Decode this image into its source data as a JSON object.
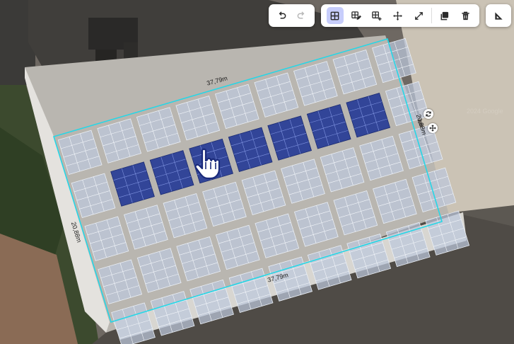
{
  "toolbar": {
    "history": [
      {
        "name": "undo-button",
        "icon": "undo-icon",
        "disabled": false
      },
      {
        "name": "redo-button",
        "icon": "redo-icon",
        "disabled": true
      }
    ],
    "tools": [
      {
        "name": "grid-select-button",
        "icon": "grid-icon",
        "active": true
      },
      {
        "name": "grid-edit-button",
        "icon": "grid-pencil-icon"
      },
      {
        "name": "grid-add-button",
        "icon": "grid-plus-icon"
      },
      {
        "name": "move-button",
        "icon": "move-arrows-icon"
      },
      {
        "name": "expand-button",
        "icon": "expand-diagonal-icon"
      },
      {
        "name": "duplicate-button",
        "icon": "copy-icon"
      },
      {
        "name": "delete-button",
        "icon": "trash-icon"
      }
    ],
    "measure": {
      "name": "measure-button",
      "icon": "ruler-triangle-icon"
    }
  },
  "dimensions": {
    "top": "37,79m",
    "bottom": "37,79m",
    "left": "20,88m",
    "right": "20,88m"
  },
  "handles": [
    {
      "name": "rotate-handle",
      "icon": "rotate-icon"
    },
    {
      "name": "move-handle",
      "icon": "move-arrows-icon"
    }
  ],
  "map": {
    "watermark": "2024 Google"
  },
  "colors": {
    "panel_selected": "#2a3f97",
    "panel_unselected": "#bcc8dc",
    "outline": "#27d6e6",
    "toolbar_active": "#c7cdfb"
  }
}
